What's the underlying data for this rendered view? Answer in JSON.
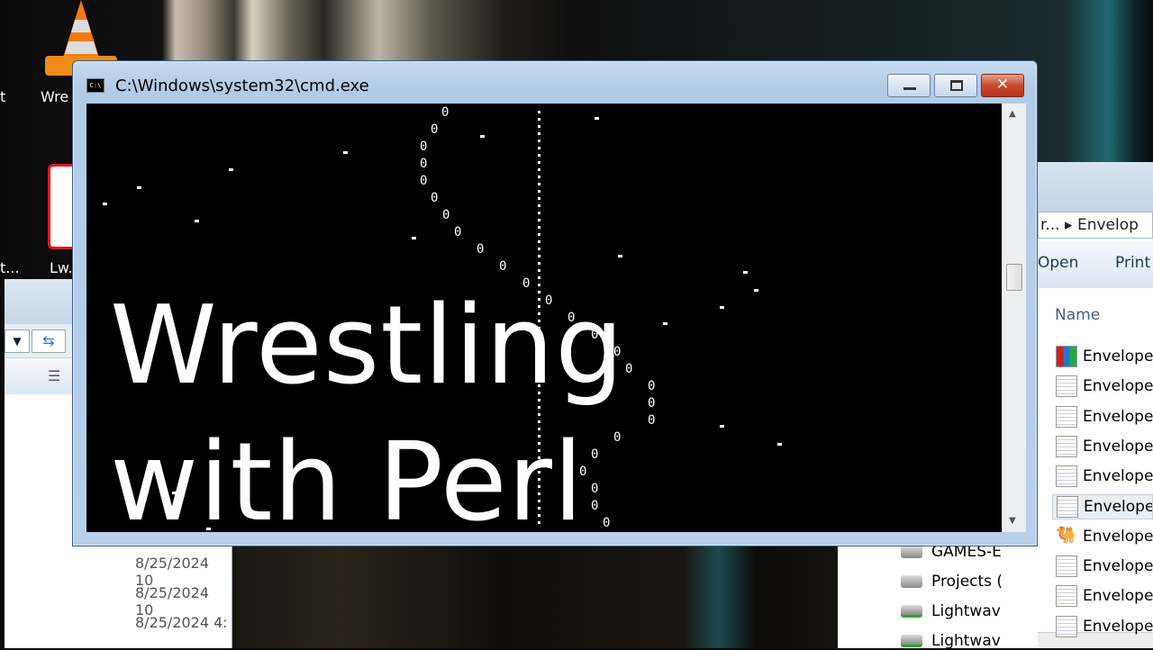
{
  "desktop": {
    "icons": [
      {
        "label": "t"
      },
      {
        "label": "Wre"
      },
      {
        "label": "t..."
      },
      {
        "label": "Lw."
      }
    ]
  },
  "cmd_window": {
    "title": "C:\\Windows\\system32\\cmd.exe",
    "icon": "cmd-icon",
    "buttons": [
      "minimize",
      "maximize",
      "close"
    ],
    "close_glyph": "✕",
    "console_char": "0",
    "overlay_text": {
      "line1": "Wrestling",
      "line2": "with  Perl"
    }
  },
  "explorer_left": {
    "dates": [
      "8/25/2024 10",
      "8/25/2024 10",
      "8/25/2024 4:"
    ]
  },
  "explorer_right": {
    "breadcrumb": "r...  ▸  Envelop",
    "toolbar": {
      "open": "Open",
      "print": "Print"
    },
    "column_header": "Name",
    "files": [
      {
        "name": "Envelope",
        "icon": "winrar-icon"
      },
      {
        "name": "Envelope",
        "icon": "text-file-icon"
      },
      {
        "name": "Envelope",
        "icon": "text-file-icon"
      },
      {
        "name": "Envelope",
        "icon": "text-file-icon"
      },
      {
        "name": "Envelope",
        "icon": "text-file-icon"
      },
      {
        "name": "Envelope",
        "icon": "settings-file-icon"
      },
      {
        "name": "Envelope",
        "icon": "perl-camel-icon"
      },
      {
        "name": "Envelope",
        "icon": "text-file-icon"
      },
      {
        "name": "Envelope",
        "icon": "text-file-icon"
      },
      {
        "name": "Envelope",
        "icon": "text-file-icon"
      }
    ],
    "nav": [
      {
        "label": "GAMES-E",
        "icon": "drive-icon"
      },
      {
        "label": "Projects (",
        "icon": "drive-icon"
      },
      {
        "label": "Lightwav",
        "icon": "network-drive-icon"
      },
      {
        "label": "Lightwav",
        "icon": "network-drive-icon"
      }
    ]
  }
}
